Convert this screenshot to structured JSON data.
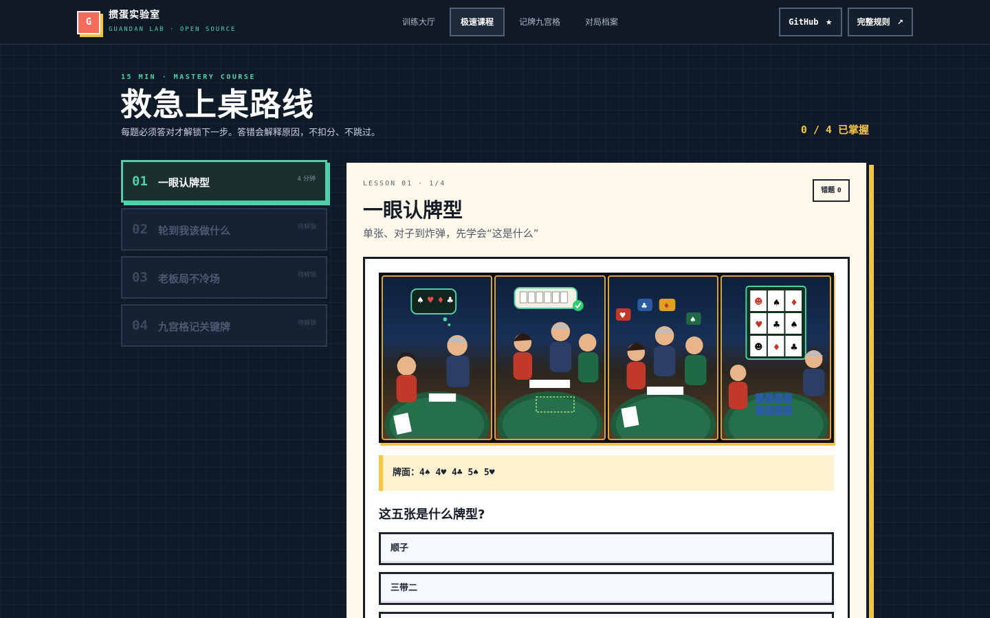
{
  "brand": {
    "logo_letter": "G",
    "name": "掼蛋实验室",
    "subtitle": "GUANDAN LAB · OPEN SOURCE"
  },
  "nav": {
    "items": [
      {
        "label": "训练大厅",
        "active": false
      },
      {
        "label": "极速课程",
        "active": true
      },
      {
        "label": "记牌九宫格",
        "active": false
      },
      {
        "label": "对局档案",
        "active": false
      }
    ]
  },
  "actions": {
    "github_label": "GitHub",
    "github_icon": "★",
    "rules_label": "完整规则",
    "rules_icon": "↗"
  },
  "hero": {
    "eyebrow": "15 MIN · MASTERY COURSE",
    "title": "救急上桌路线",
    "subtitle": "每题必须答对才解锁下一步。答错会解释原因，不扣分、不跳过。",
    "progress": "0 / 4 已掌握"
  },
  "lessons": [
    {
      "num": "01",
      "title": "一眼认牌型",
      "meta": "4 分钟",
      "active": true
    },
    {
      "num": "02",
      "title": "轮到我该做什么",
      "meta": "待解锁",
      "active": false
    },
    {
      "num": "03",
      "title": "老板局不冷场",
      "meta": "待解锁",
      "active": false
    },
    {
      "num": "04",
      "title": "九宫格记关键牌",
      "meta": "待解锁",
      "active": false
    }
  ],
  "lesson": {
    "kicker": "LESSON 01 · 1/4",
    "title": "一眼认牌型",
    "description": "单张、对子到炸弹，先学会“这是什么”",
    "mistakes_label": "错题",
    "mistakes_count": "0"
  },
  "quiz": {
    "hand_label": "牌面：",
    "hand_cards": "4♠ 4♥ 4♣ 5♠ 5♥",
    "question": "这五张是什么牌型?",
    "options": [
      "顺子",
      "三带二",
      ""
    ]
  },
  "colors": {
    "accent_green": "#4fd1a8",
    "accent_yellow": "#f5c542",
    "brand_red": "#f26b5b",
    "background": "#0f1a29",
    "card_bg": "#fdf8ea"
  }
}
